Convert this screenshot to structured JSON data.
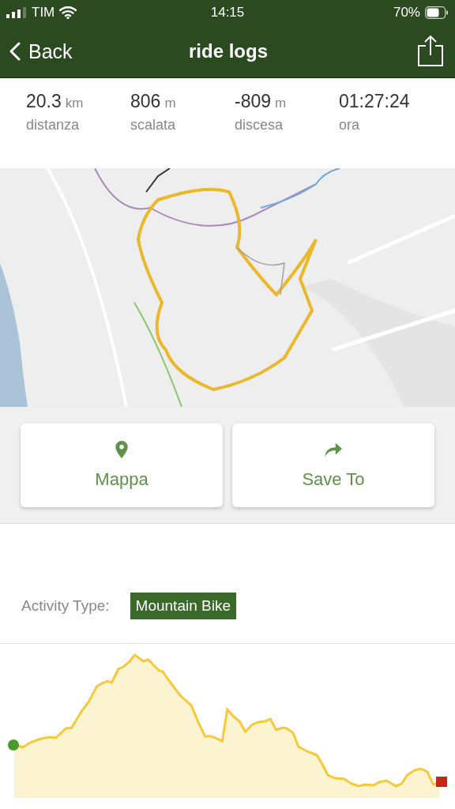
{
  "status_bar": {
    "carrier": "TIM",
    "time": "14:15",
    "battery": "70%"
  },
  "nav": {
    "back": "Back",
    "title": "ride logs"
  },
  "stats": [
    {
      "value": "20.3",
      "unit": "km",
      "label": "distanza"
    },
    {
      "value": "806",
      "unit": "m",
      "label": "scalata"
    },
    {
      "value": "-809",
      "unit": "m",
      "label": "discesa"
    },
    {
      "value": "01:27:24",
      "label": "ora"
    }
  ],
  "actions": [
    {
      "label": "Mappa",
      "kind": "map"
    },
    {
      "label": "Save To",
      "kind": "share"
    }
  ],
  "activity": {
    "label": "Activity Type:",
    "value": "Mountain Bike"
  }
}
